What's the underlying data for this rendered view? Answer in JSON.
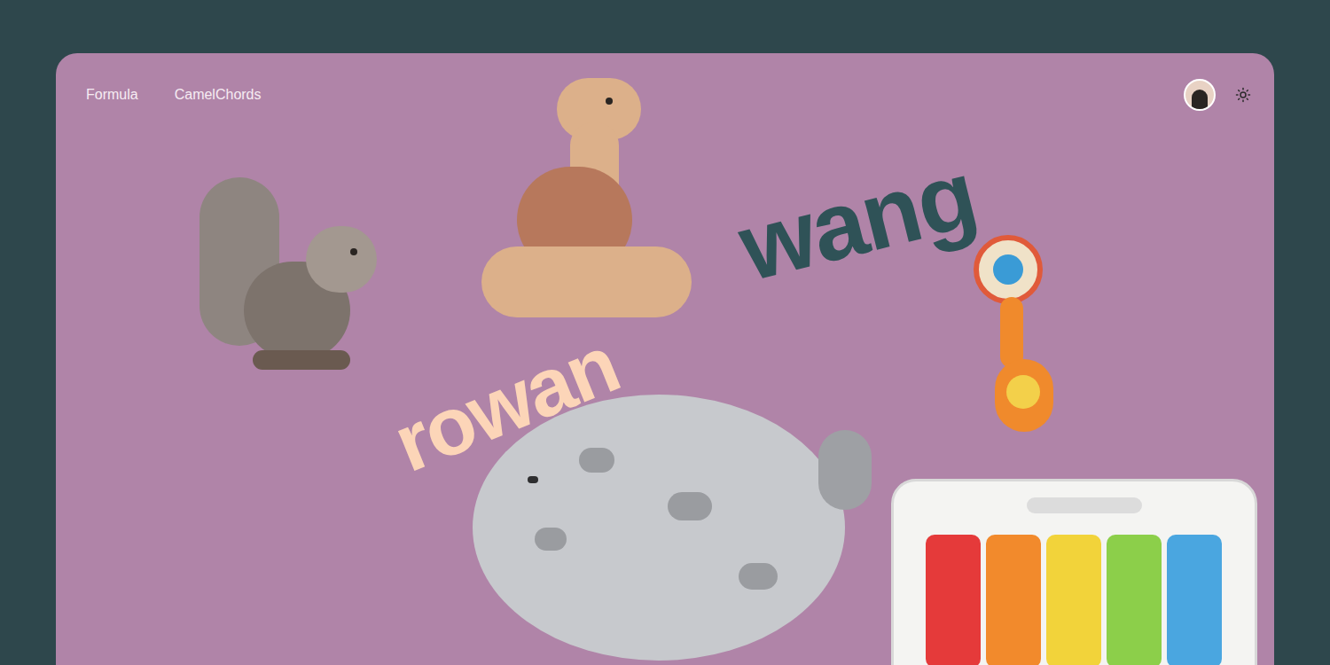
{
  "nav": {
    "links": [
      {
        "label": "Formula"
      },
      {
        "label": "CamelChords"
      }
    ]
  },
  "hero": {
    "first_name": "rowan",
    "last_name": "wang"
  }
}
